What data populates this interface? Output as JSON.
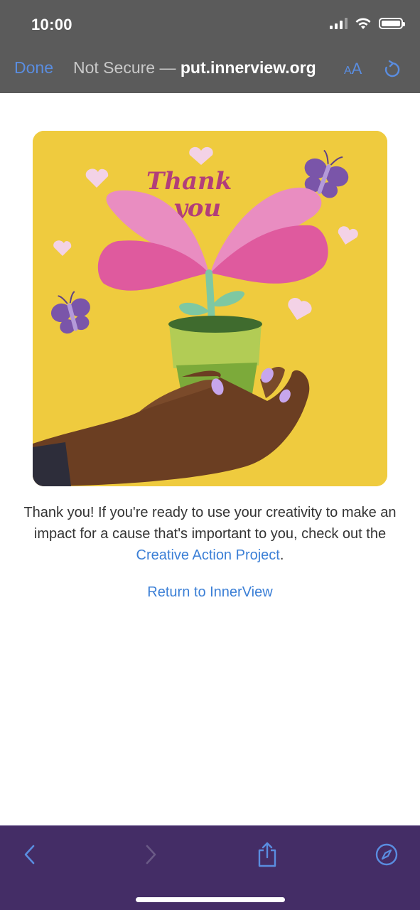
{
  "status_bar": {
    "time": "10:00"
  },
  "browser_header": {
    "done_label": "Done",
    "security_text": "Not Secure —",
    "domain_text": "put.innerview.org",
    "text_size_icon": "AA",
    "reload_icon": "reload-icon"
  },
  "content": {
    "illustration": {
      "lettering": "Thank you",
      "description_icons": [
        "hand-icon",
        "flower-pot-icon",
        "butterfly-icon",
        "heart-icon"
      ]
    },
    "message_part1": "Thank you! If you're ready to use your creativity to make an impact for a cause that's important to you, check out the ",
    "message_link": "Creative Action Project",
    "message_end": ".",
    "return_link": "Return to InnerView"
  },
  "bottom_toolbar": {
    "icons": [
      "back-icon",
      "forward-icon",
      "share-icon",
      "compass-icon"
    ]
  },
  "colors": {
    "header_bg": "#5b5b5b",
    "accent_blue": "#5a8de0",
    "link_blue": "#3b7fd6",
    "toolbar_bg": "#442d66",
    "hero_yellow": "#efcb3e"
  }
}
